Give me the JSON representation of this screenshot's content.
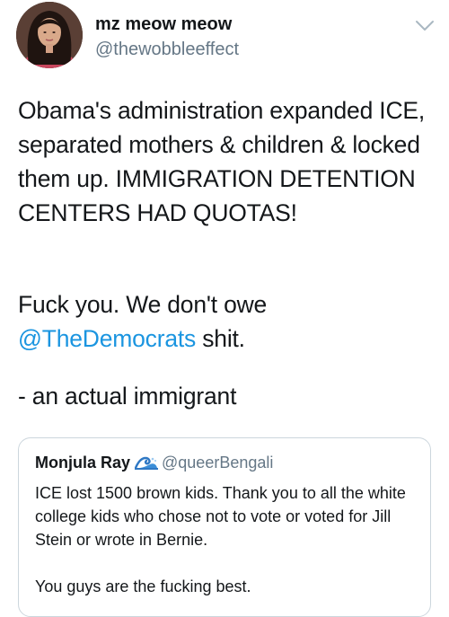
{
  "tweet": {
    "author": {
      "display_name": "mz meow meow",
      "handle": "@thewobbleeffect"
    },
    "body": {
      "paragraph_1": "Obama's administration expanded ICE, separated mothers & children & locked them up. IMMIGRATION DETENTION CENTERS HAD QUOTAS!",
      "paragraph_2_prefix": "Fuck you. We don't owe",
      "paragraph_2_mention": "@TheDemocrats",
      "paragraph_2_suffix": " shit.",
      "paragraph_3": "- an actual immigrant"
    }
  },
  "quoted_tweet": {
    "display_name": "Monjula Ray",
    "handle": "@queerBengali",
    "paragraph_1": "ICE lost 1500 brown kids. Thank you to all the white college kids who chose not to vote or voted for Jill Stein or wrote in Bernie.",
    "paragraph_2": "You guys are the fucking best."
  },
  "icons": {
    "menu_caret": "chevron-down-icon",
    "name_emoji": "wave-icon",
    "avatar": "avatar-photo"
  },
  "colors": {
    "text": "#14171a",
    "secondary_text": "#657786",
    "link": "#1b95e0",
    "border": "#ccd6dd"
  }
}
